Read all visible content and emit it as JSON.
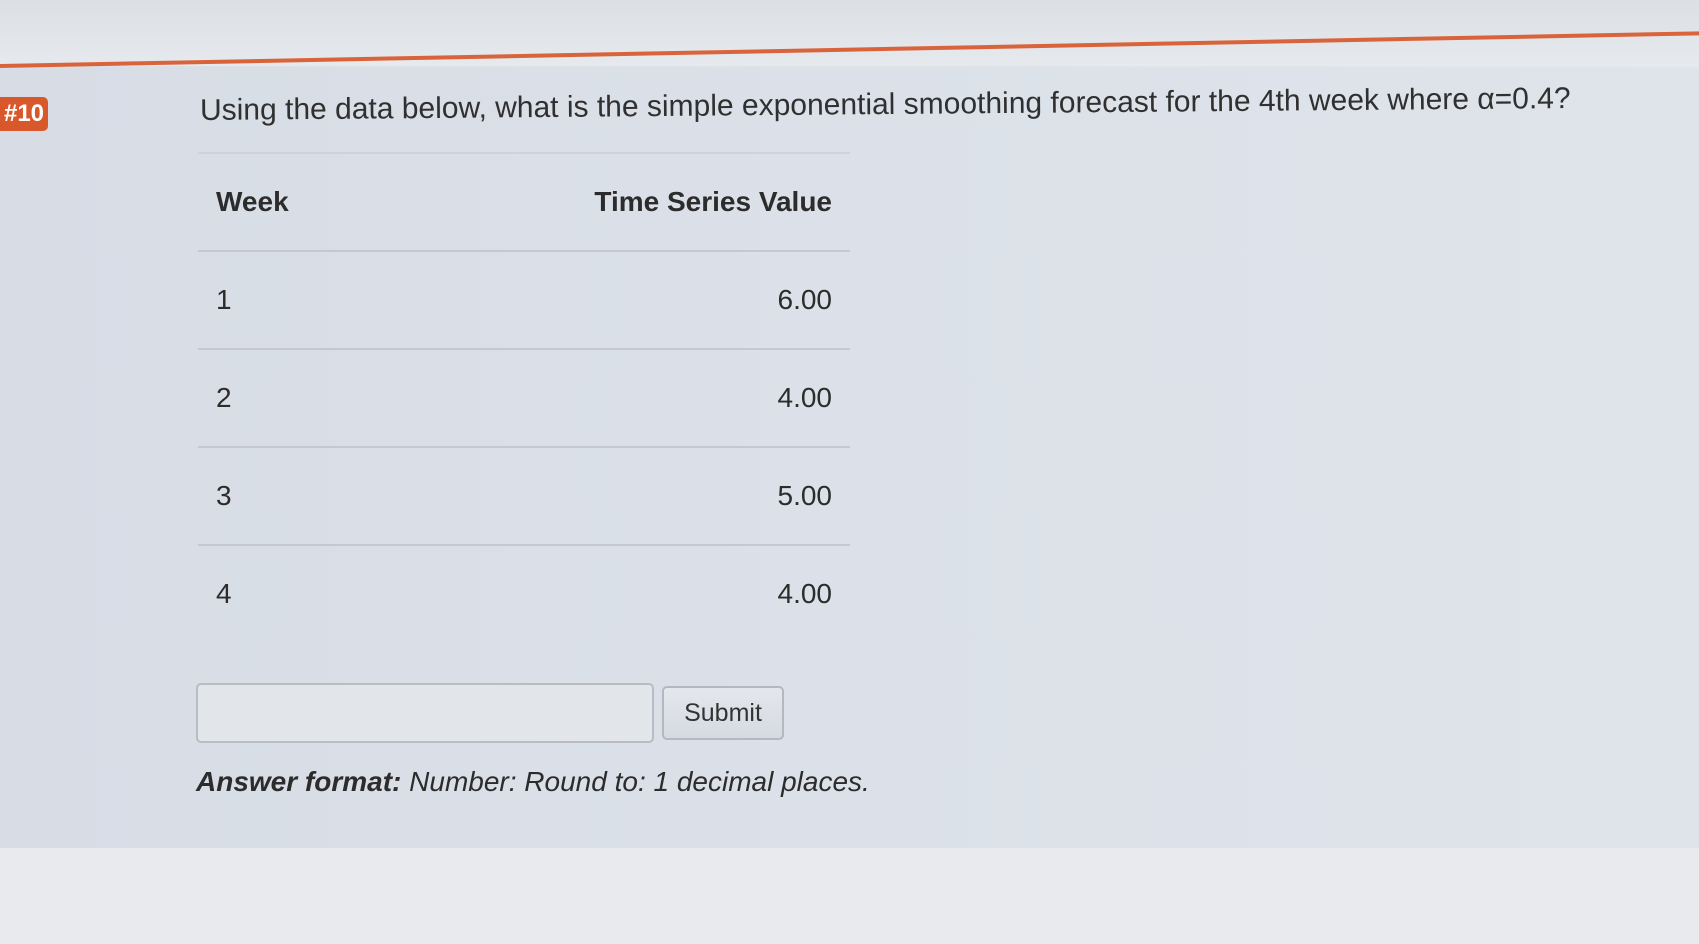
{
  "question": {
    "badge": "#10",
    "text": "Using the data below, what is the simple exponential smoothing forecast for the 4th week where α=0.4?"
  },
  "table": {
    "headers": [
      "Week",
      "Time Series Value"
    ],
    "rows": [
      {
        "week": "1",
        "value": "6.00"
      },
      {
        "week": "2",
        "value": "4.00"
      },
      {
        "week": "3",
        "value": "5.00"
      },
      {
        "week": "4",
        "value": "4.00"
      }
    ]
  },
  "answer": {
    "input_value": "",
    "submit_label": "Submit",
    "format_label": "Answer format:",
    "format_text": "Number: Round to: 1 decimal places."
  },
  "colors": {
    "accent": "#d9633b",
    "badge": "#d9582b"
  }
}
